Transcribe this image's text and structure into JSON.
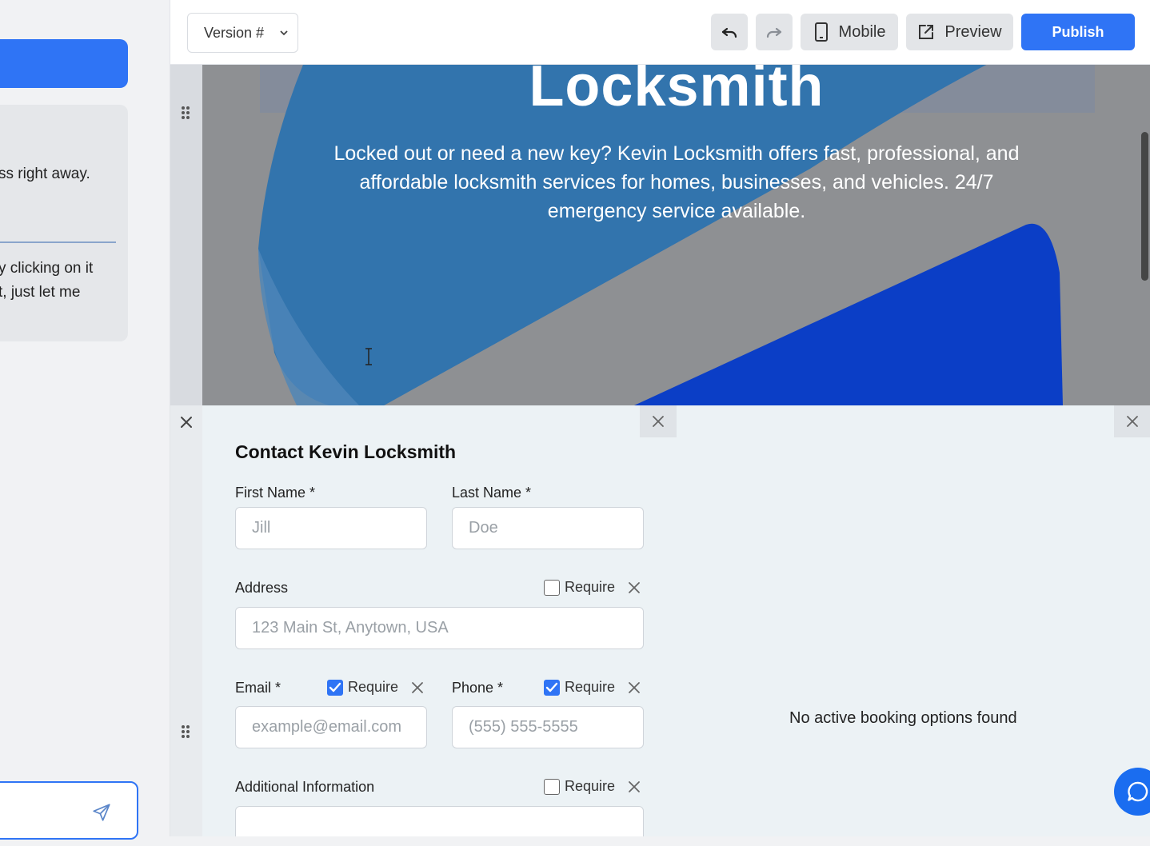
{
  "chat": {
    "line1": "ss right away.",
    "line2": "y clicking on it",
    "line3": "t, just let me"
  },
  "toolbar": {
    "version_label": "Version #",
    "mobile_label": "Mobile",
    "preview_label": "Preview",
    "publish_label": "Publish"
  },
  "hero": {
    "title": "Locksmith",
    "subtitle": "Locked out or need a new key? Kevin Locksmith offers fast, professional, and affordable locksmith services for homes, businesses, and vehicles. 24/7 emergency service available."
  },
  "form": {
    "title": "Contact Kevin Locksmith",
    "first_name_label": "First Name *",
    "first_name_placeholder": "Jill",
    "last_name_label": "Last Name *",
    "last_name_placeholder": "Doe",
    "address_label": "Address",
    "address_placeholder": "123 Main St, Anytown, USA",
    "email_label": "Email *",
    "email_placeholder": "example@email.com",
    "phone_label": "Phone *",
    "phone_placeholder": "(555) 555-5555",
    "additional_label": "Additional Information",
    "require_label": "Require"
  },
  "booking": {
    "empty_text": "No active booking options found"
  },
  "colors": {
    "accent": "#2f74f5",
    "hero_blue": "#2f6eaa",
    "hero_dark_blue": "#0a3fc4"
  }
}
